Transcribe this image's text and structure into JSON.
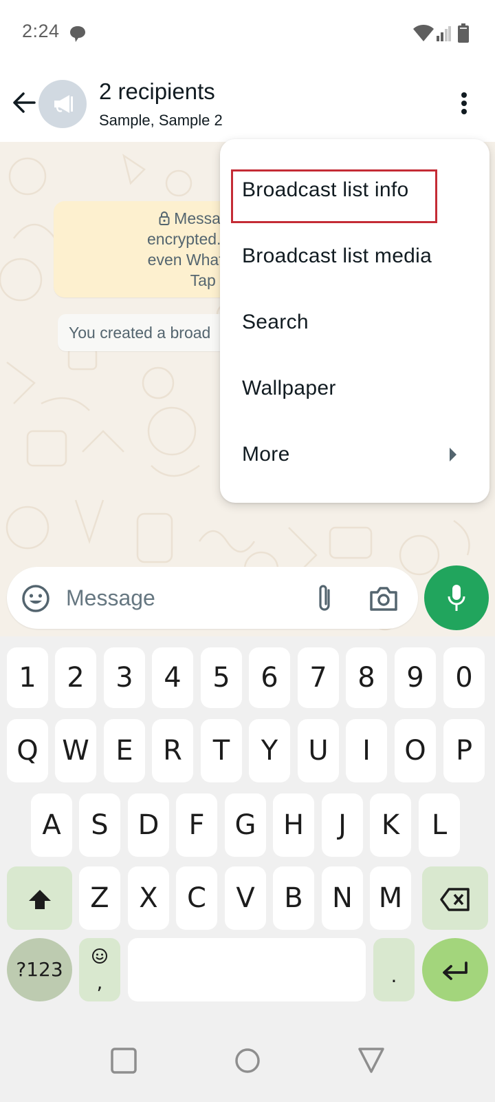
{
  "status_bar": {
    "time": "2:24",
    "icons": [
      "chat-notification-icon",
      "wifi-icon",
      "signal-icon",
      "battery-icon"
    ]
  },
  "app_bar": {
    "back_icon": "arrow-left-icon",
    "avatar_icon": "megaphone-icon",
    "title": "2 recipients",
    "subtitle": "Sample, Sample 2",
    "menu_icon": "more-vert-icon"
  },
  "chat": {
    "encryption_notice": {
      "lines": [
        "Messages ar",
        "encrypted. No one",
        "even WhatsApp, c",
        "Tap to"
      ]
    },
    "system_message": "You created a broad"
  },
  "overflow_menu": {
    "items": [
      {
        "label": "Broadcast list info",
        "highlighted": true
      },
      {
        "label": "Broadcast list media"
      },
      {
        "label": "Search"
      },
      {
        "label": "Wallpaper"
      },
      {
        "label": "More",
        "has_submenu": true
      }
    ]
  },
  "composer": {
    "placeholder": "Message",
    "emoji_icon": "emoji-icon",
    "attach_icon": "paperclip-icon",
    "camera_icon": "camera-icon",
    "mic_icon": "microphone-icon",
    "accent_color": "#21a55d"
  },
  "keyboard": {
    "row1": [
      "1",
      "2",
      "3",
      "4",
      "5",
      "6",
      "7",
      "8",
      "9",
      "0"
    ],
    "row2": [
      "Q",
      "W",
      "E",
      "R",
      "T",
      "Y",
      "U",
      "I",
      "O",
      "P"
    ],
    "row3": [
      "A",
      "S",
      "D",
      "F",
      "G",
      "H",
      "J",
      "K",
      "L"
    ],
    "row4": [
      "Z",
      "X",
      "C",
      "V",
      "B",
      "N",
      "M"
    ],
    "symbols_label": "?123",
    "comma_label": ",",
    "period_label": ".",
    "shift_icon": "shift-icon",
    "backspace_icon": "backspace-icon",
    "enter_icon": "enter-icon"
  },
  "nav_bar": {
    "icons": [
      "recents-icon",
      "home-icon",
      "back-icon"
    ]
  }
}
